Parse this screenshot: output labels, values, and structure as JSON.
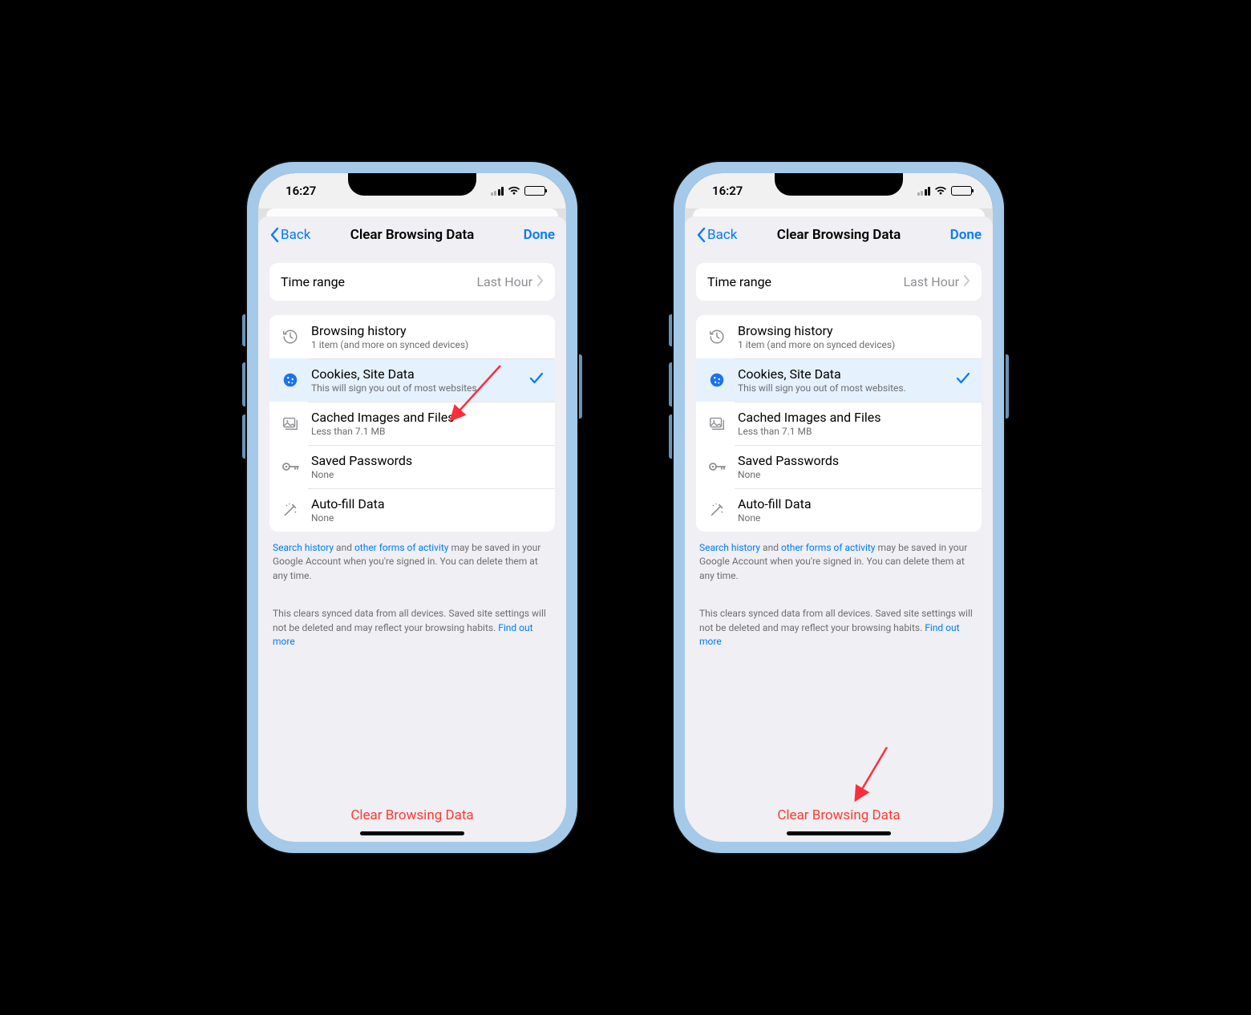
{
  "status": {
    "time": "16:27"
  },
  "nav": {
    "back": "Back",
    "title": "Clear Browsing Data",
    "done": "Done"
  },
  "timeRange": {
    "label": "Time range",
    "value": "Last Hour"
  },
  "items": [
    {
      "title": "Browsing history",
      "sub": "1 item (and more on synced devices)",
      "icon": "history",
      "selected": false
    },
    {
      "title": "Cookies, Site Data",
      "sub": "This will sign you out of most websites.",
      "icon": "cookie",
      "selected": true
    },
    {
      "title": "Cached Images and Files",
      "sub": "Less than 7.1 MB",
      "icon": "image",
      "selected": false
    },
    {
      "title": "Saved Passwords",
      "sub": "None",
      "icon": "key",
      "selected": false
    },
    {
      "title": "Auto-fill Data",
      "sub": "None",
      "icon": "wand",
      "selected": false
    }
  ],
  "footnote1": {
    "link1": "Search history",
    "mid": " and ",
    "link2": "other forms of activity",
    "rest": " may be saved in your Google Account when you're signed in. You can delete them at any time."
  },
  "footnote2": {
    "text": "This clears synced data from all devices. Saved site settings will not be deleted and may reflect your browsing habits. ",
    "link": "Find out more"
  },
  "clearButton": "Clear Browsing Data",
  "annotations": {
    "arrowColor": "#ff2d3a"
  }
}
